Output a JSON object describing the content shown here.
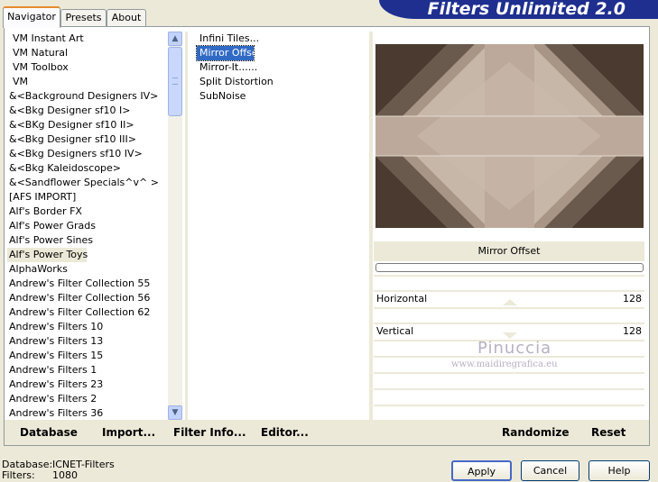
{
  "tabs": [
    {
      "label": "Navigator",
      "active": true
    },
    {
      "label": "Presets",
      "active": false
    },
    {
      "label": "About",
      "active": false
    }
  ],
  "brand": "Filters Unlimited 2.0",
  "categories": [
    "VM Instant Art",
    "VM Natural",
    "VM Toolbox",
    "VM",
    "&<Background Designers IV>",
    "&<Bkg Designer sf10 I>",
    "&<BKg Designer sf10 II>",
    "&<Bkg Designer sf10 III>",
    "&<Bkg Designers sf10 IV>",
    "&<Bkg Kaleidoscope>",
    "&<Sandflower Specials^v^ >",
    "[AFS IMPORT]",
    "Alf's Border FX",
    "Alf's Power Grads",
    "Alf's Power Sines",
    "Alf's Power Toys",
    "AlphaWorks",
    "Andrew's Filter Collection 55",
    "Andrew's Filter Collection 56",
    "Andrew's Filter Collection 62",
    "Andrew's Filters 10",
    "Andrew's Filters 13",
    "Andrew's Filters 15",
    "Andrew's Filters 1",
    "Andrew's Filters 23",
    "Andrew's Filters 2",
    "Andrew's Filters 36"
  ],
  "selected_category": "Alf's Power Toys",
  "filters": [
    "Infini Tiles...",
    "Mirror Offset",
    "Mirror-It......",
    "Split Distortion",
    "SubNoise"
  ],
  "selected_filter": "Mirror Offset",
  "panel": {
    "filter_name": "Mirror Offset",
    "params": [
      {
        "label": "Horizontal",
        "value": "128"
      },
      {
        "label": "Vertical",
        "value": "128"
      }
    ]
  },
  "watermark": {
    "name": "Pinuccia",
    "url": "www.maidiregrafica.eu"
  },
  "toolbar": {
    "database": "Database",
    "import": "Import...",
    "filter_info": "Filter Info...",
    "editor": "Editor...",
    "randomize": "Randomize",
    "reset": "Reset"
  },
  "status": {
    "database_label": "Database:",
    "database_value": "ICNET-Filters",
    "filters_label": "Filters:",
    "filters_value": "1080"
  },
  "buttons": {
    "apply": "Apply",
    "cancel": "Cancel",
    "help": "Help"
  },
  "colors": {
    "brand_bg": "#1e2f8f",
    "selection": "#316ac5",
    "tab_accent": "#e68b2c"
  }
}
